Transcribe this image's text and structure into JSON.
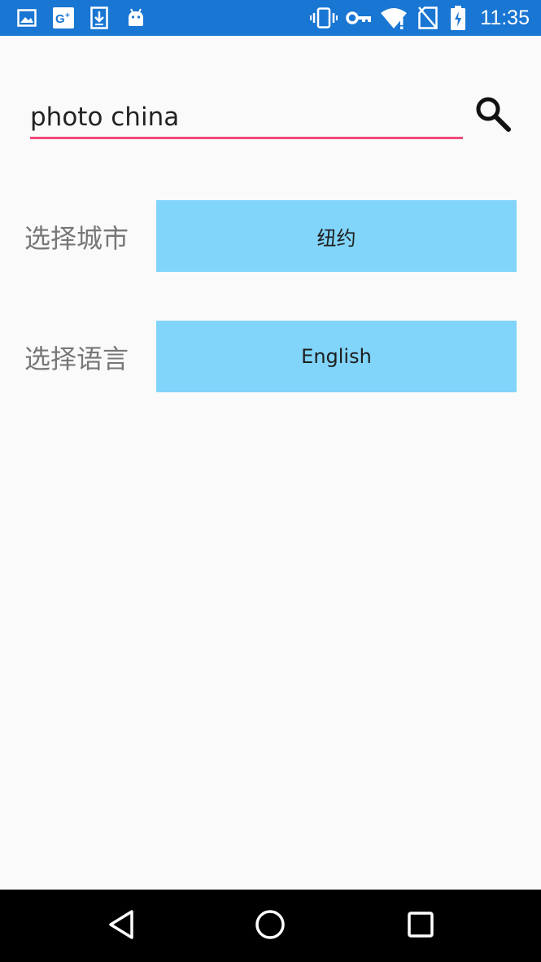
{
  "status_bar": {
    "time": "11:35",
    "left_icons": [
      "image-icon",
      "google-plus-icon",
      "download-icon",
      "android-icon"
    ],
    "right_icons": [
      "vibrate-icon",
      "vpn-key-icon",
      "wifi-alert-icon",
      "no-sim-icon",
      "battery-charging-icon"
    ],
    "background": "#1976d2"
  },
  "search": {
    "value": "photo china",
    "underline_color": "#ef4a7b",
    "button_icon": "search-icon"
  },
  "city_row": {
    "label": "选择城市",
    "value": "纽约"
  },
  "language_row": {
    "label": "选择语言",
    "value": "English"
  },
  "button_color": "#81d4fa",
  "nav_bar": {
    "buttons": [
      "back-icon",
      "home-icon",
      "recents-icon"
    ]
  }
}
